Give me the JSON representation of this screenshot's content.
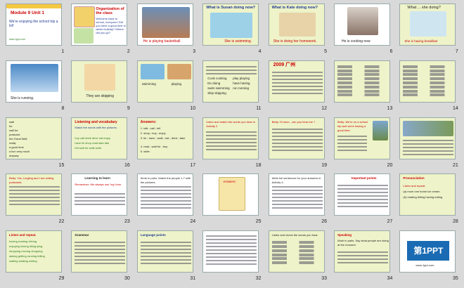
{
  "slides": [
    {
      "n": "1",
      "title": "Module 9 Unit 1",
      "sub": "We're enjoying the school trip a lot!",
      "foot": "www.1ppt.com"
    },
    {
      "n": "2",
      "title": "Organization of the class",
      "sub": "Welcome back to school, everyone! Did you have a good time in winter holiday? Where did you go?"
    },
    {
      "n": "3",
      "caption": "He is playing basketball."
    },
    {
      "n": "4",
      "title": "What is Susan doing now?",
      "caption": "She is swimming."
    },
    {
      "n": "5",
      "title": "What is Kate doing now?",
      "caption": "She is doing her homework."
    },
    {
      "n": "6",
      "caption": "He is cooking now"
    },
    {
      "n": "7",
      "title": "What ... she doing?",
      "caption": "She is having breakfast"
    },
    {
      "n": "8",
      "caption": "She is running."
    },
    {
      "n": "9",
      "caption": "They are skipping"
    },
    {
      "n": "10",
      "labels": [
        "swimming",
        "playing"
      ]
    },
    {
      "n": "11",
      "lines": [
        "Cook cooking",
        "play playing",
        "Do doing",
        "have having",
        "swim swimming",
        "run running",
        "Skip skipping"
      ]
    },
    {
      "n": "12",
      "title": "2009 广州"
    },
    {
      "n": "13"
    },
    {
      "n": "14"
    },
    {
      "n": "15",
      "items": [
        "wait",
        "for",
        "wall for",
        "postcard",
        "the Great Wall",
        "really",
        "a good time",
        "a lion very much",
        "anyway"
      ]
    },
    {
      "n": "16",
      "title": "Listening and vocabulary",
      "sub": "Match the words with the pictures.",
      "lines": [
        "buy call drink drive eat enjoy",
        "have lie shop read take talk",
        "tell wait for walk write"
      ]
    },
    {
      "n": "17",
      "title": "Answers:",
      "lines": [
        "1. talk ; call ; tell",
        "2. shop ; buy ; enjoy",
        "3. lie ; have ; walk ; eat ; drink ; take",
        "4. read ; wait for ; buy",
        "5. write"
      ]
    },
    {
      "n": "18",
      "title": "Listen and match the words you hear in Activity 2."
    },
    {
      "n": "19",
      "title": "Betty: Hi mum , can you hear me ?"
    },
    {
      "n": "20",
      "title": "Betty: We're on a school trip and we're having a good time."
    },
    {
      "n": "21"
    },
    {
      "n": "22",
      "title": "Betty: Yes, Lingling and I are writing postcards."
    },
    {
      "n": "23",
      "title": "Learning to learn",
      "sub": "Remember: We always use 'ing' form"
    },
    {
      "n": "24",
      "title": "Work in pairs. Match the people 1-7 with the pictures."
    },
    {
      "n": "25",
      "title": "Answers:"
    },
    {
      "n": "26",
      "title": "Write full sentences for your answers in Activity 4."
    },
    {
      "n": "27",
      "title": "Important points"
    },
    {
      "n": "28",
      "title": "Pronunciation",
      "lines": [
        "Listen and repeat.",
        "(a) mum one home ice cream",
        "(b) reading telling having eating"
      ]
    },
    {
      "n": "29",
      "title": "Listen and repeat.",
      "lines": [
        "having reading driving",
        "enjoying having liking lying",
        "shopping moving shopping",
        "asking getting running telling",
        "waiting walking writing"
      ]
    },
    {
      "n": "30",
      "title": "Grammar"
    },
    {
      "n": "31",
      "title": "Language points"
    },
    {
      "n": "32"
    },
    {
      "n": "33",
      "title": "Listen and check the words you hear."
    },
    {
      "n": "34",
      "title": "Speaking",
      "sub": "Work in pairs. Say what people are doing at the moment."
    },
    {
      "n": "35",
      "logo": "第1PPT",
      "logo_sub": "www.1ppt.com"
    }
  ],
  "colors": {
    "background": "#d9d9d9",
    "slide": "#eef3c9",
    "title_red": "#cc0000",
    "accent_blue": "#1a6bb3"
  }
}
